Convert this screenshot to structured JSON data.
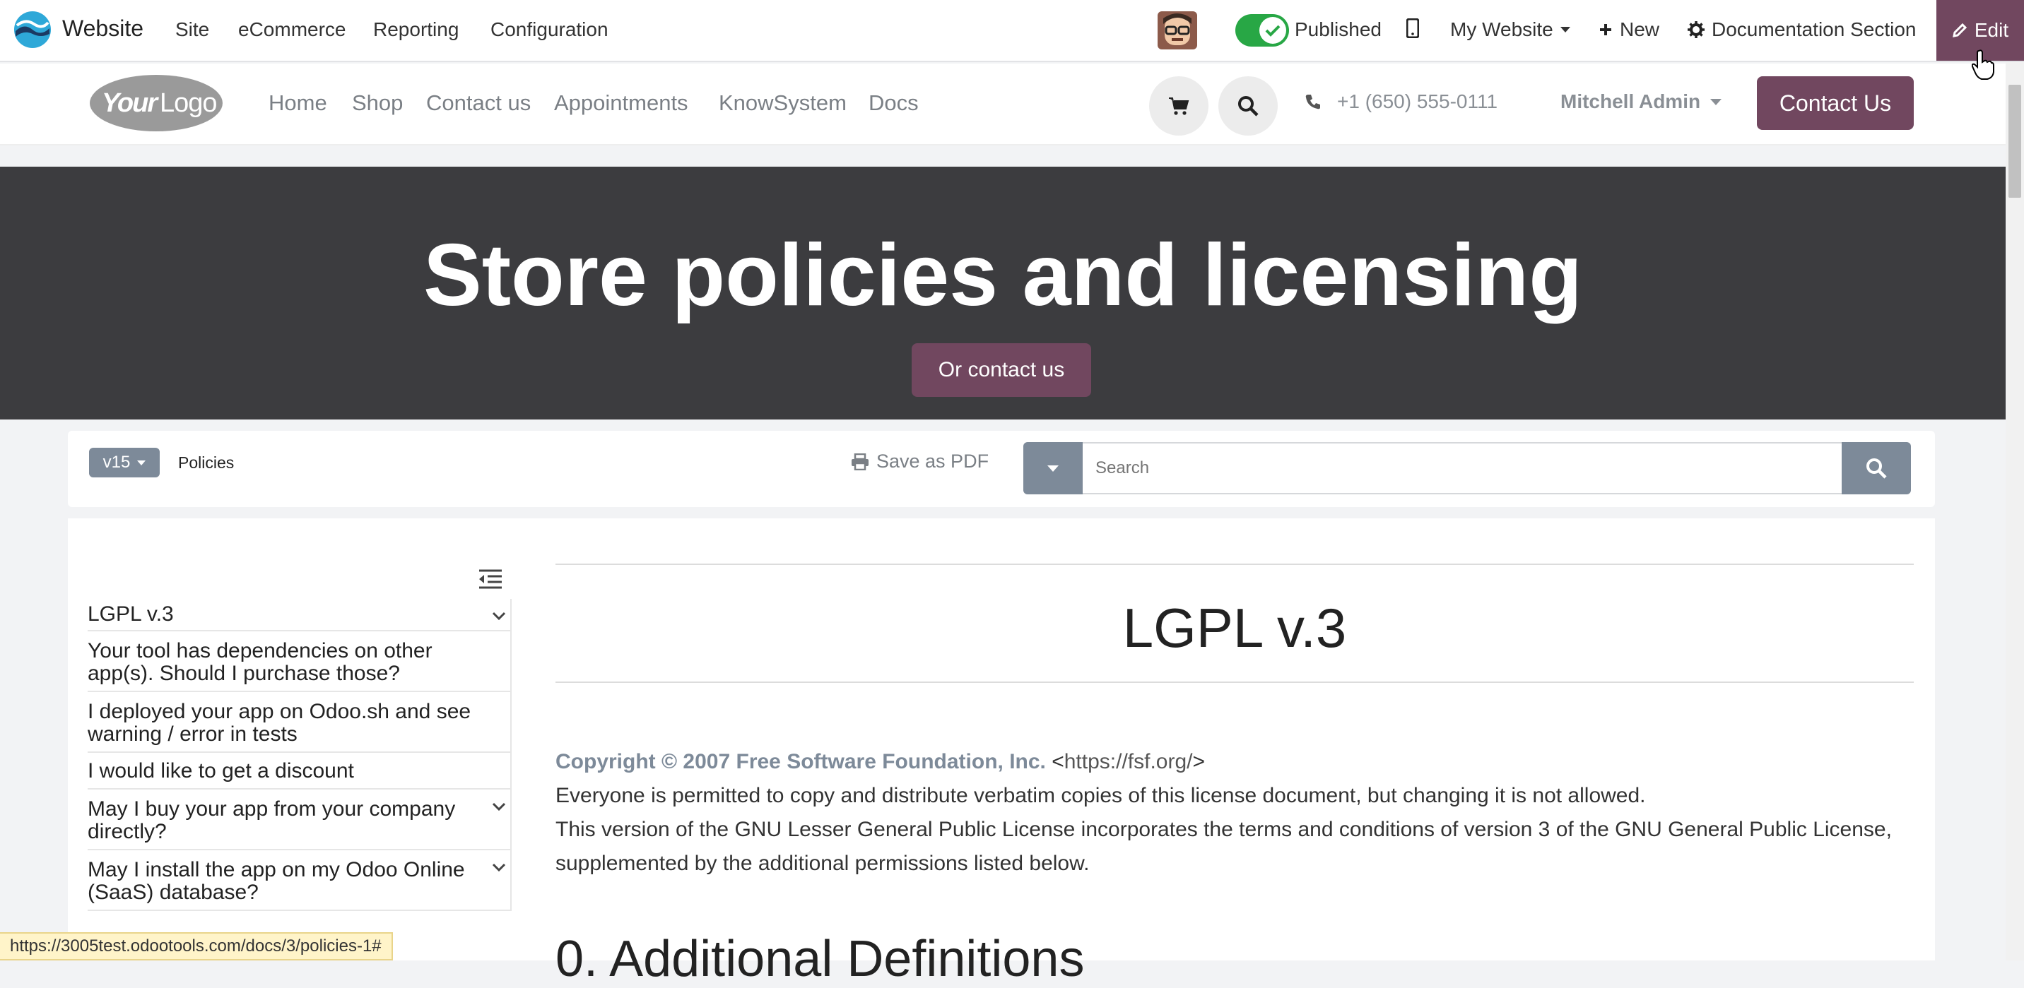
{
  "topbar": {
    "app_name": "Website",
    "menu": [
      "Site",
      "eCommerce",
      "Reporting",
      "Configuration"
    ],
    "published_label": "Published",
    "published": true,
    "website_switcher": "My Website",
    "new_label": "New",
    "section_label": "Documentation Section",
    "edit_label": "Edit"
  },
  "site_header": {
    "logo_text": "YourLogo",
    "nav": [
      "Home",
      "Shop",
      "Contact us",
      "Appointments",
      "KnowSystem",
      "Docs"
    ],
    "phone": "+1 (650) 555-0111",
    "user": "Mitchell Admin",
    "cta": "Contact Us"
  },
  "hero": {
    "title": "Store policies and licensing",
    "button": "Or contact us"
  },
  "doc_toolbar": {
    "version": "v15",
    "breadcrumb": "Policies",
    "save_pdf": "Save as PDF",
    "search_placeholder": "Search"
  },
  "toc": {
    "items": [
      {
        "label": "LGPL v.3",
        "expandable": true
      },
      {
        "label": "Your tool has dependencies on other app(s). Should I purchase those?",
        "expandable": false
      },
      {
        "label": "I deployed your app on Odoo.sh and see warning / error in tests",
        "expandable": false
      },
      {
        "label": "I would like to get a discount",
        "expandable": false
      },
      {
        "label": "May I buy your app from your company directly?",
        "expandable": true
      },
      {
        "label": "May I install the app on my Odoo Online (SaaS) database?",
        "expandable": true
      }
    ]
  },
  "article": {
    "title": "LGPL v.3",
    "copyright": "Copyright © 2007 Free Software Foundation, Inc.",
    "link": "https://fsf.org/",
    "para1": "Everyone is permitted to copy and distribute verbatim copies of this license document, but changing it is not allowed.",
    "para2": "This version of the GNU Lesser General Public License incorporates the terms and conditions of version 3 of the GNU General Public License, supplemented by the additional permissions listed below.",
    "heading": "0. Additional Definitions"
  },
  "status_url": "https://3005test.odootools.com/docs/3/policies-1#",
  "colors": {
    "brand": "#71475f",
    "toggle_on": "#28a745",
    "muted": "#7d8a99",
    "hero_bg": "#3c3c3f"
  },
  "icons": [
    "odoo-logo-icon",
    "avatar",
    "mobile-icon",
    "plus-icon",
    "gear-icon",
    "pencil-icon",
    "cart-icon",
    "search-icon",
    "phone-icon",
    "caret-down-icon",
    "printer-icon",
    "toc-collapse-icon",
    "chevron-down-icon"
  ]
}
